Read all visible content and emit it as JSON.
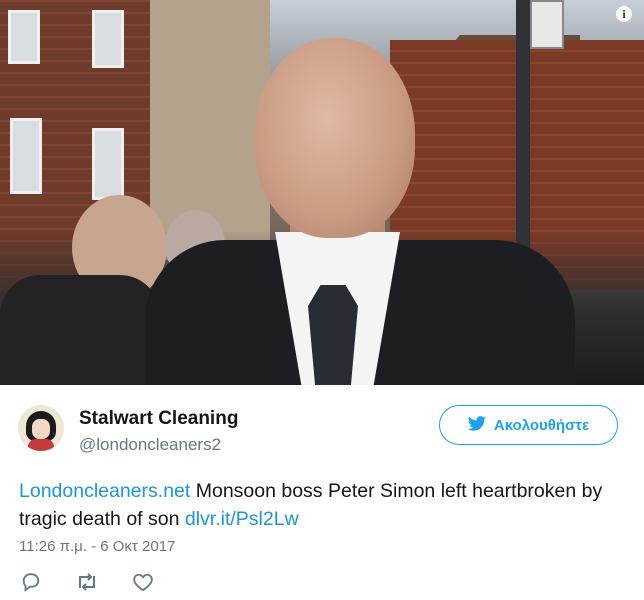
{
  "tweet": {
    "display_name": "Stalwart Cleaning",
    "handle": "@londoncleaners2",
    "follow_label": "Ακολουθήστε",
    "text_link_start": "Londoncleaners.net",
    "text_body": " Monsoon boss Peter Simon left heartbroken by tragic death of son ",
    "text_link_end": "dlvr.it/Psl2Lw",
    "timestamp": "11:26 π.μ. - 6 Οκτ 2017"
  },
  "photo": {
    "info_glyph": "i"
  },
  "icons": {
    "info": "info-icon",
    "twitter_bird": "twitter-bird-icon",
    "reply": "reply-icon",
    "retweet": "retweet-icon",
    "like": "heart-icon"
  },
  "colors": {
    "brand_blue": "#1da1f2",
    "link_blue": "#1b95e0",
    "secondary_text": "#657786",
    "primary_text": "#14171a"
  }
}
